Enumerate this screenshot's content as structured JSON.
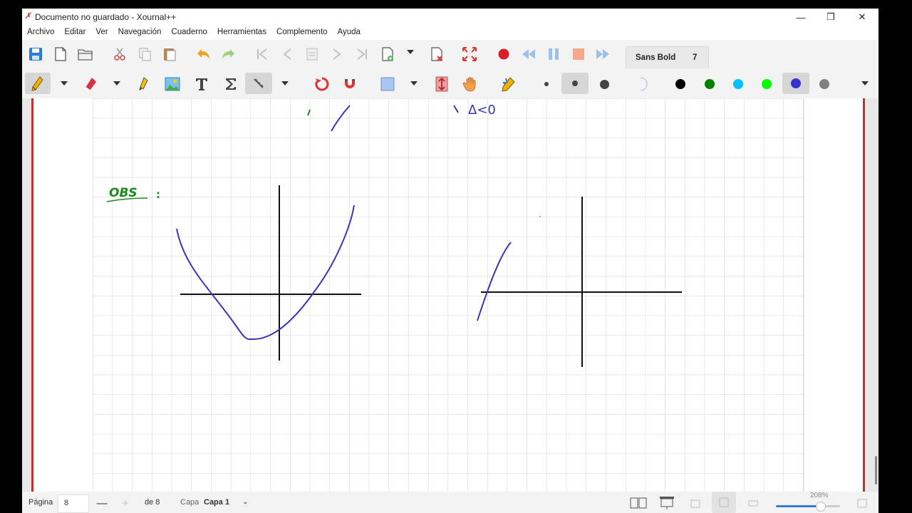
{
  "window": {
    "title": "Documento no guardado - Xournal++",
    "app_icon": "xournal-icon",
    "controls": {
      "minimize": "—",
      "maximize": "❐",
      "close": "✕"
    }
  },
  "menu": [
    "Archivo",
    "Editar",
    "Ver",
    "Navegación",
    "Cuaderno",
    "Herramientas",
    "Complemento",
    "Ayuda"
  ],
  "toolbar_main": {
    "font_name": "Sans Bold",
    "font_size": "7",
    "icons": [
      "save-icon",
      "new-icon",
      "open-icon",
      "cut-icon",
      "copy-icon",
      "paste-icon",
      "undo-icon",
      "redo-icon",
      "goto-first-icon",
      "goto-back-icon",
      "goto-page-icon",
      "goto-next-icon",
      "goto-last-icon",
      "new-page-icon",
      "delete-page-icon",
      "fullscreen-icon",
      "record-icon",
      "rewind-icon",
      "pause-icon",
      "stop-icon",
      "forward-icon"
    ]
  },
  "toolbar_tools": {
    "icons": [
      "pen-icon",
      "eraser-icon",
      "highlighter-icon",
      "image-icon",
      "text-icon",
      "latex-icon",
      "ruler-icon",
      "rotation-snap-icon",
      "grid-snap-icon",
      "select-rect-icon",
      "vertical-space-icon",
      "hand-icon",
      "default-tool-icon",
      "fine-icon",
      "medium-icon",
      "thick-icon",
      "fill-icon"
    ],
    "colors": [
      "#000000",
      "#008000",
      "#00c0ff",
      "#00ff00",
      "#3333cc",
      "#808080"
    ],
    "selected_color": "#3333cc"
  },
  "status": {
    "page_label": "Página",
    "page_value": "8",
    "minus": "—",
    "plus": "+",
    "of_label": "de 8",
    "layer_label": "Capa",
    "layer_value": "Capa 1",
    "zoom": "208%"
  },
  "ink": {
    "blue": "#3a35b5",
    "green": "#1f8a1f",
    "black": "#111111",
    "obs_text": "OBS",
    "delta_text": "Δ<0"
  }
}
